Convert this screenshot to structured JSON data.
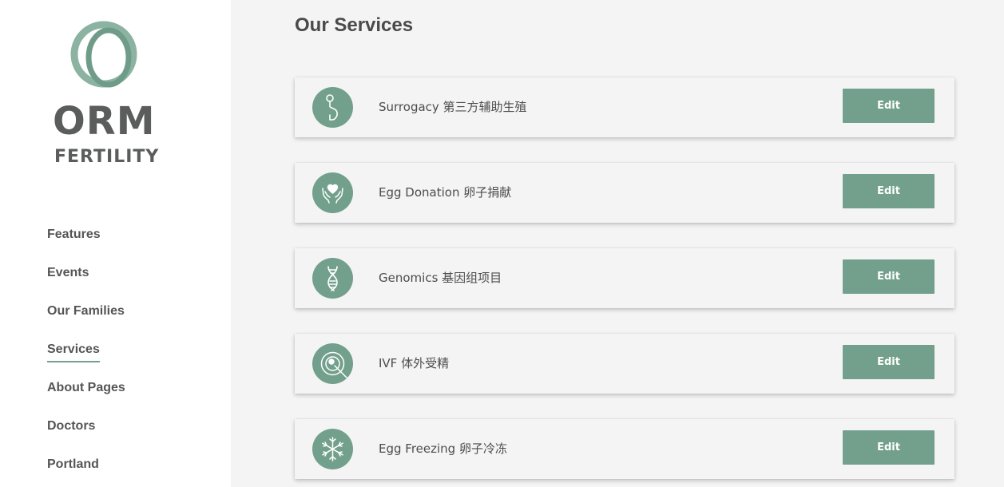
{
  "brand": {
    "line1": "ORM",
    "line2": "FERTILITY",
    "accent": "#73a08d",
    "logo_text_color": "#5b5d5c"
  },
  "nav": {
    "items": [
      {
        "label": "Features",
        "active": false
      },
      {
        "label": "Events",
        "active": false
      },
      {
        "label": "Our Families",
        "active": false
      },
      {
        "label": "Services",
        "active": true
      },
      {
        "label": "About Pages",
        "active": false
      },
      {
        "label": "Doctors",
        "active": false
      },
      {
        "label": "Portland",
        "active": false
      }
    ]
  },
  "main": {
    "title": "Our Services",
    "services": [
      {
        "name": "Surrogacy 第三方辅助生殖",
        "icon": "surrogacy-icon",
        "edit_label": "Edit"
      },
      {
        "name": "Egg Donation 卵子捐献",
        "icon": "hands-heart-icon",
        "edit_label": "Edit"
      },
      {
        "name": "Genomics 基因组项目",
        "icon": "dna-icon",
        "edit_label": "Edit"
      },
      {
        "name": "IVF 体外受精",
        "icon": "ivf-needle-egg-icon",
        "edit_label": "Edit"
      },
      {
        "name": "Egg Freezing 卵子冷冻",
        "icon": "snowflake-icon",
        "edit_label": "Edit"
      }
    ]
  }
}
